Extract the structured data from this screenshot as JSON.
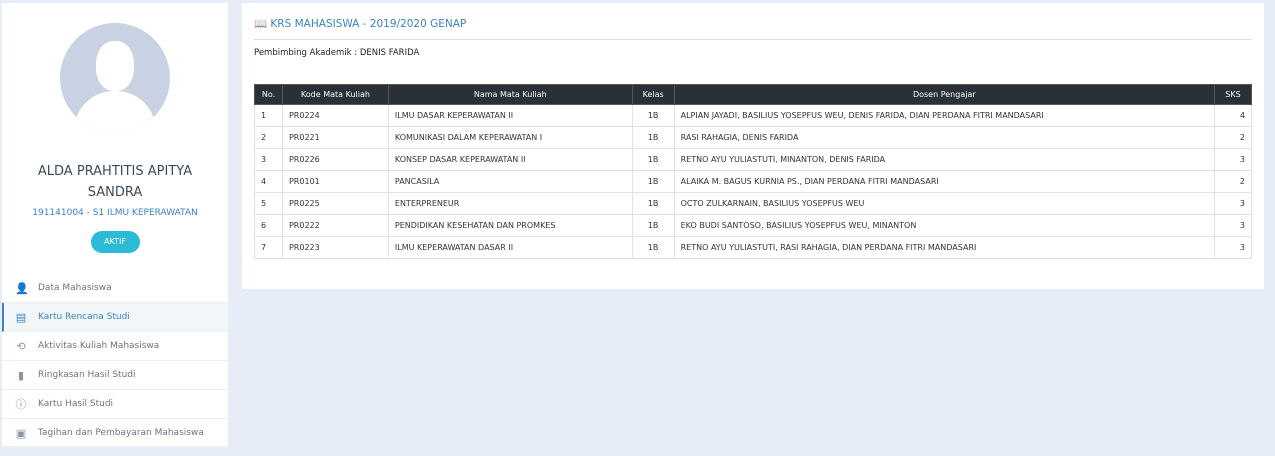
{
  "profile": {
    "name": "ALDA PRAHTITIS APITYA SANDRA",
    "nim": "191141004 - S1 ILMU KEPERAWATAN",
    "status": "AKTIF"
  },
  "menu": [
    {
      "label": "Data Mahasiswa",
      "icon": "user-icon"
    },
    {
      "label": "Kartu Rencana Studi",
      "icon": "list-icon",
      "active": true
    },
    {
      "label": "Aktivitas Kuliah Mahasiswa",
      "icon": "history-icon"
    },
    {
      "label": "Ringkasan Hasil Studi",
      "icon": "file-icon"
    },
    {
      "label": "Kartu Hasil Studi",
      "icon": "info-icon"
    },
    {
      "label": "Tagihan dan Pembayaran Mahasiswa",
      "icon": "money-icon"
    }
  ],
  "main": {
    "title": "KRS MAHASISWA - 2019/2020 GENAP",
    "advisor": "Pembimbing Akademik : DENIS FARIDA",
    "headers": [
      "No.",
      "Kode Mata Kuliah",
      "Nama Mata Kuliah",
      "Kelas",
      "Dosen Pengajar",
      "SKS"
    ],
    "rows": [
      [
        "1",
        "PR0224",
        "ILMU DASAR KEPERAWATAN II",
        "1B",
        "ALPIAN JAYADI, BASILIUS YOSEPFUS WEU, DENIS FARIDA, DIAN PERDANA FITRI MANDASARI",
        "4"
      ],
      [
        "2",
        "PR0221",
        "KOMUNIKASI DALAM KEPERAWATAN I",
        "1B",
        "RASI RAHAGIA, DENIS FARIDA",
        "2"
      ],
      [
        "3",
        "PR0226",
        "KONSEP DASAR KEPERAWATAN II",
        "1B",
        "RETNO AYU YULIASTUTI, MINANTON, DENIS FARIDA",
        "3"
      ],
      [
        "4",
        "PR0101",
        "PANCASILA",
        "1B",
        "ALAIKA M. BAGUS KURNIA PS., DIAN PERDANA FITRI MANDASARI",
        "2"
      ],
      [
        "5",
        "PR0225",
        "ENTERPRENEUR",
        "1B",
        "OCTO ZULKARNAIN, BASILIUS YOSEPFUS WEU",
        "3"
      ],
      [
        "6",
        "PR0222",
        "PENDIDIKAN KESEHATAN DAN PROMKES",
        "1B",
        "EKO BUDI SANTOSO, BASILIUS YOSEPFUS WEU, MINANTON",
        "3"
      ],
      [
        "7",
        "PR0223",
        "ILMU KEPERAWATAN DASAR II",
        "1B",
        "RETNO AYU YULIASTUTI, RASI RAHAGIA, DIAN PERDANA FITRI MANDASARI",
        "3"
      ]
    ]
  }
}
